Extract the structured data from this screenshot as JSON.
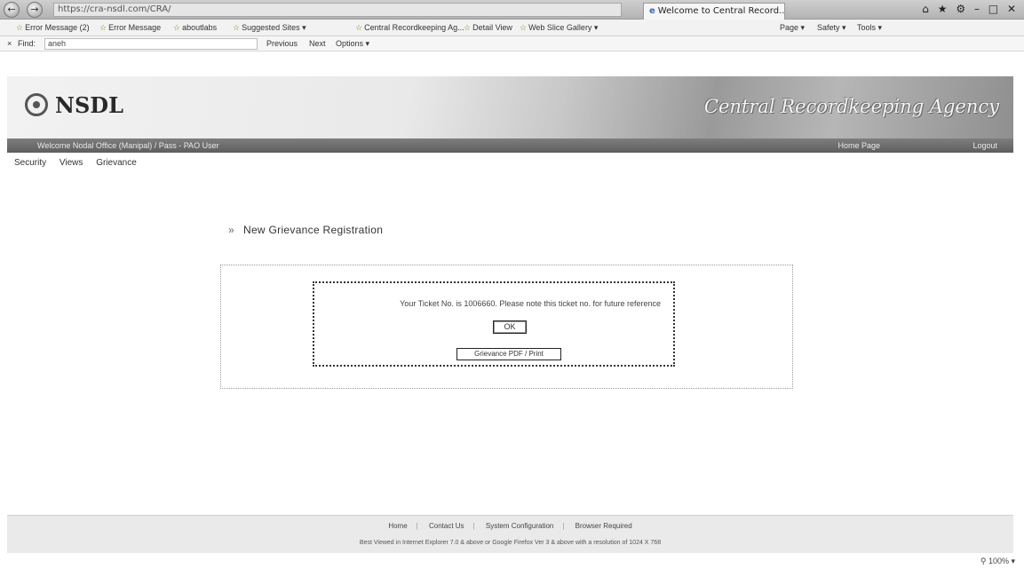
{
  "browser": {
    "address": "https://cra-nsdl.com/CRA/",
    "active_tab": "Welcome to Central Record...",
    "favorites": [
      "Error Message (2)",
      "Error Message",
      "aboutlabs",
      "Suggested Sites ▾",
      "Central Recordkeeping Ag...",
      "Detail View",
      "Web Slice Gallery ▾"
    ],
    "commands": [
      "Page ▾",
      "Safety ▾",
      "Tools ▾"
    ],
    "find": {
      "label": "Find:",
      "value": "aneh",
      "previous": "Previous",
      "next": "Next",
      "options": "Options ▾"
    },
    "zoom": "100%"
  },
  "page": {
    "logo": "NSDL",
    "agency_title": "Central Recordkeeping Agency",
    "welcome_text": "Welcome Nodal Office (Manipal) / Pass - PAO User",
    "strip_links": [
      "Home Page",
      "Logout"
    ],
    "menu": [
      "Security",
      "Views",
      "Grievance"
    ],
    "section_title": "New Grievance Registration",
    "dialog": {
      "message": "Your Ticket No. is 1006660. Please note this ticket no. for future reference",
      "ok_label": "OK",
      "print_label": "Grievance PDF / Print"
    },
    "footer": {
      "links": [
        "Home",
        "Contact Us",
        "System Configuration",
        "Browser Required"
      ],
      "note": "Best Viewed in Internet Explorer 7.0 & above or Google Firefox Ver 3 & above with a resolution of 1024 X 768"
    }
  }
}
